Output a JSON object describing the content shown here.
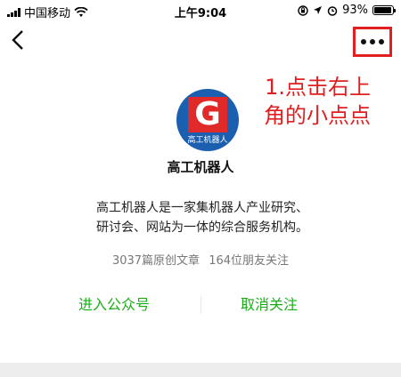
{
  "status_bar": {
    "carrier": "中国移动",
    "time": "上午9:04",
    "battery_percent_label": "93%",
    "battery_level": 0.93
  },
  "nav": {
    "back_icon": "chevron-left-icon",
    "more_icon": "more-dots-icon"
  },
  "annotation": {
    "line1": "1.点击右上",
    "line2": "角的小点点",
    "color": "#e02020"
  },
  "account": {
    "logo_letter": "G",
    "logo_text": "高工机器人",
    "name": "高工机器人",
    "description": "高工机器人是一家集机器人产业研究、研讨会、网站为一体的综合服务机构。",
    "original_articles": "3037篇原创文章",
    "friends_following": "164位朋友关注"
  },
  "actions": {
    "enter_label": "进入公众号",
    "unfollow_label": "取消关注",
    "accent_color": "#1aad19"
  }
}
